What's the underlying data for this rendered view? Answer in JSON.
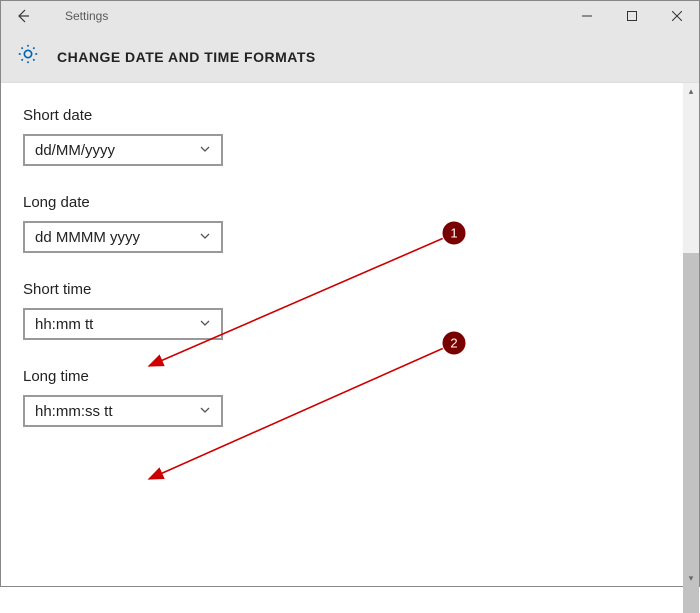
{
  "titlebar": {
    "app_title": "Settings"
  },
  "header": {
    "heading": "CHANGE DATE AND TIME FORMATS"
  },
  "fields": {
    "short_date": {
      "label": "Short date",
      "value": "dd/MM/yyyy"
    },
    "long_date": {
      "label": "Long date",
      "value": "dd MMMM yyyy"
    },
    "short_time": {
      "label": "Short time",
      "value": "hh:mm tt"
    },
    "long_time": {
      "label": "Long time",
      "value": "hh:mm:ss tt"
    }
  },
  "annotations": {
    "callout1": "1",
    "callout2": "2"
  },
  "colors": {
    "accent": "#0063B1",
    "callout": "#790000"
  }
}
